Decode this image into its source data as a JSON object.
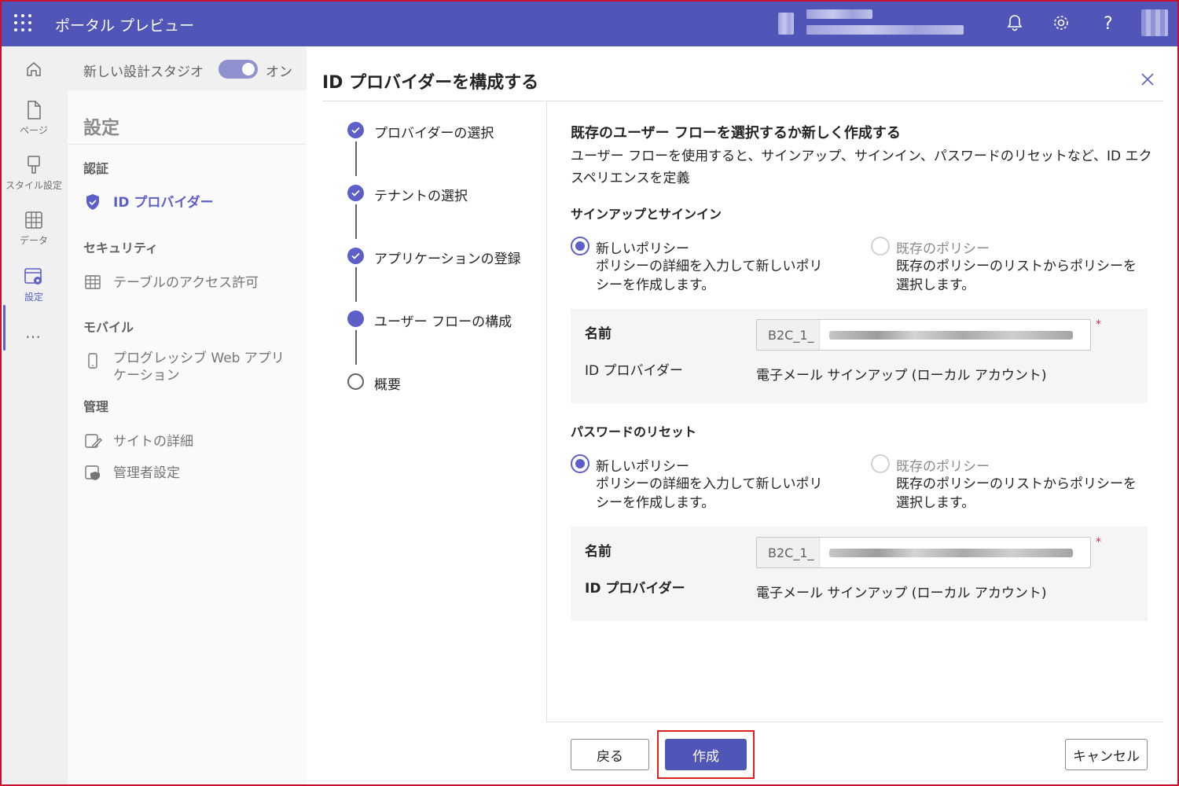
{
  "app": {
    "title": "ポータル プレビュー"
  },
  "topbar": {
    "icons": [
      "bell-icon",
      "gear-icon",
      "help-icon"
    ],
    "accent": "#5055b8"
  },
  "rail": {
    "items": [
      {
        "icon": "home-icon",
        "label": ""
      },
      {
        "icon": "page-icon",
        "label": "ページ"
      },
      {
        "icon": "brush-icon",
        "label": "スタイル設定"
      },
      {
        "icon": "table-icon",
        "label": "データ"
      },
      {
        "icon": "settings-icon",
        "label": "設定"
      }
    ],
    "more": "…"
  },
  "studio_toggle": {
    "label": "新しい設計スタジオ",
    "state": "オン"
  },
  "settings": {
    "title": "設定",
    "sections": [
      {
        "heading": "認証",
        "items": [
          {
            "label": "ID プロバイダー",
            "icon": "shield-icon",
            "active": true
          }
        ]
      },
      {
        "heading": "セキュリティ",
        "items": [
          {
            "label": "テーブルのアクセス許可",
            "icon": "table-icon"
          }
        ]
      },
      {
        "heading": "モバイル",
        "items": [
          {
            "label": "プログレッシブ Web アプリケーション",
            "icon": "phone-icon"
          }
        ]
      },
      {
        "heading": "管理",
        "items": [
          {
            "label": "サイトの詳細",
            "icon": "edit-icon"
          },
          {
            "label": "管理者設定",
            "icon": "admin-icon"
          }
        ]
      }
    ]
  },
  "panel": {
    "title": "ID プロバイダーを構成する",
    "steps": [
      {
        "label": "プロバイダーの選択",
        "status": "done"
      },
      {
        "label": "テナントの選択",
        "status": "done"
      },
      {
        "label": "アプリケーションの登録",
        "status": "done"
      },
      {
        "label": "ユーザー フローの構成",
        "status": "current"
      },
      {
        "label": "概要",
        "status": "todo"
      }
    ],
    "heading": "既存のユーザー フローを選択するか新しく作成する",
    "description": "ユーザー フローを使用すると、サインアップ、サインイン、パスワードのリセットなど、ID エクスペリエンスを定義",
    "signup": {
      "heading": "サインアップとサインイン",
      "new_title": "新しいポリシー",
      "new_desc_1": "ポリシーの詳細を入力して新しいポリ",
      "new_desc_2": "シーを作成します。",
      "existing_title": "既存のポリシー",
      "existing_desc_1": "既存のポリシーのリストからポリシーを",
      "existing_desc_2": "選択します。",
      "name_label": "名前",
      "name_prefix": "B2C_1_",
      "required": "*",
      "idp_label": "ID プロバイダー",
      "idp_value": "電子メール サインアップ (ローカル アカウント)"
    },
    "reset": {
      "heading": "パスワードのリセット",
      "new_title": "新しいポリシー",
      "new_desc_1": "ポリシーの詳細を入力して新しいポリ",
      "new_desc_2": "シーを作成します。",
      "existing_title": "既存のポリシー",
      "existing_desc_1": "既存のポリシーのリストからポリシーを",
      "existing_desc_2": "選択します。",
      "name_label": "名前",
      "name_prefix": "B2C_1_",
      "required": "*",
      "idp_label": "ID プロバイダー",
      "idp_value": "電子メール サインアップ (ローカル アカウント)"
    },
    "buttons": {
      "back": "戻る",
      "create": "作成",
      "cancel": "キャンセル"
    }
  }
}
